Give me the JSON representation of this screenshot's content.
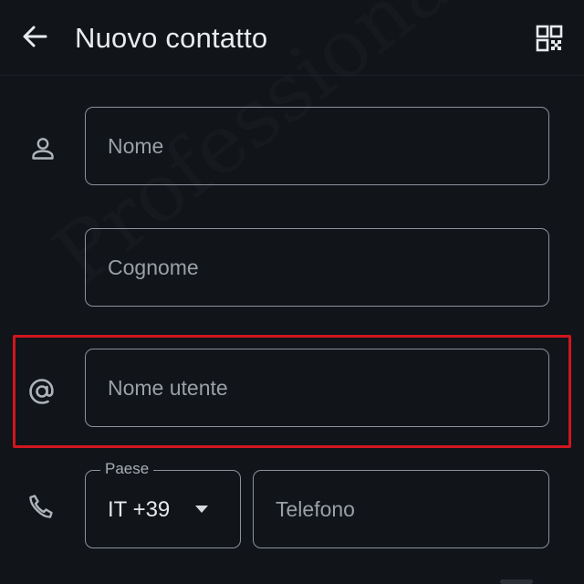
{
  "appbar": {
    "title": "Nuovo contatto",
    "back_icon": "arrow-left-icon",
    "qr_icon": "qr-code-icon"
  },
  "form": {
    "first_name": {
      "placeholder": "Nome",
      "value": "",
      "icon": "person-icon"
    },
    "last_name": {
      "placeholder": "Cognome",
      "value": ""
    },
    "username": {
      "placeholder": "Nome utente",
      "value": "",
      "icon": "at-sign-icon",
      "highlighted": true
    },
    "phone": {
      "icon": "phone-icon",
      "country_label": "Paese",
      "country_value": "IT +39",
      "placeholder": "Telefono",
      "value": ""
    }
  },
  "watermark": "ProfessionaleInformatico",
  "colors": {
    "background": "#111419",
    "field_border": "#8d929b",
    "highlight": "#d0161f",
    "text": "#e6e8ec",
    "placeholder": "#9aa0a8"
  }
}
